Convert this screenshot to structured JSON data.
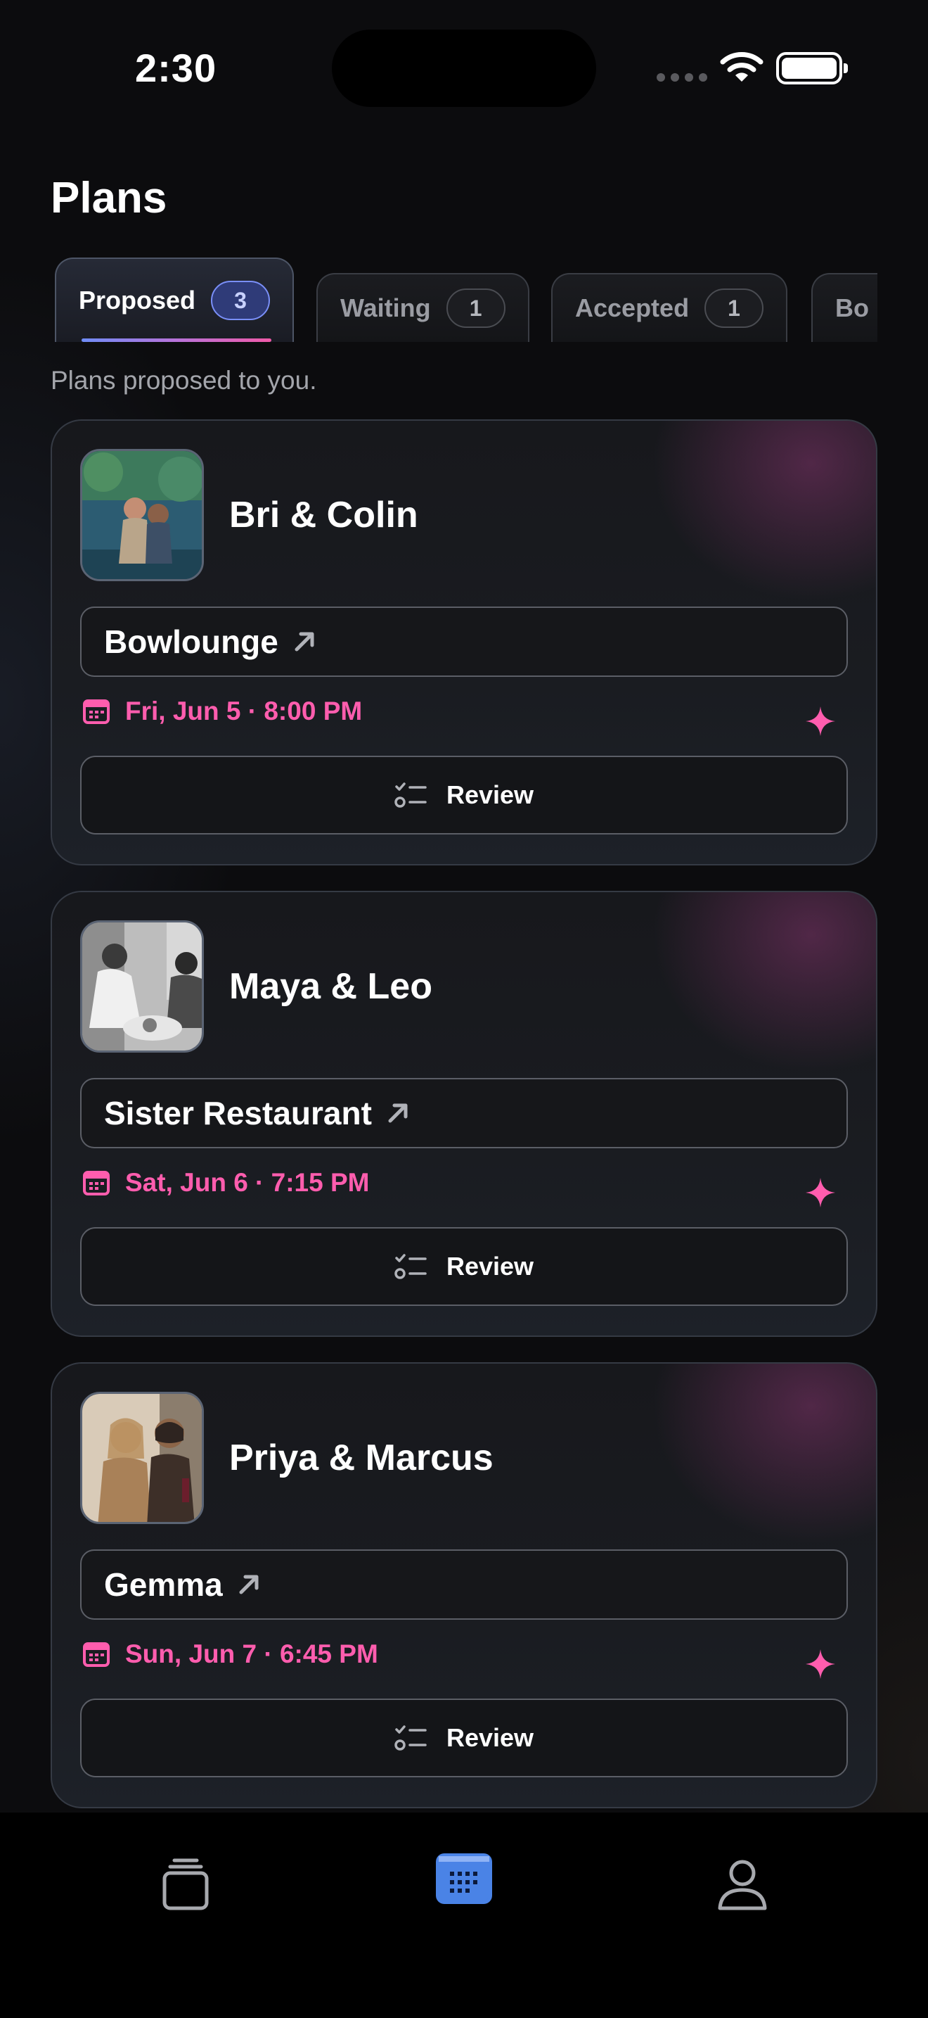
{
  "status_bar": {
    "time": "2:30"
  },
  "page": {
    "title": "Plans",
    "subtitle": "Plans proposed to you."
  },
  "tabs": [
    {
      "label": "Proposed",
      "count": "3",
      "active": true
    },
    {
      "label": "Waiting",
      "count": "1",
      "active": false
    },
    {
      "label": "Accepted",
      "count": "1",
      "active": false
    },
    {
      "label": "Bo",
      "count": "",
      "active": false
    }
  ],
  "plans": [
    {
      "names": "Bri & Colin",
      "venue": "Bowlounge",
      "date": "Fri, Jun 5 · 8:00 PM",
      "action": "Review"
    },
    {
      "names": "Maya & Leo",
      "venue": "Sister Restaurant",
      "date": "Sat, Jun 6 · 7:15 PM",
      "action": "Review"
    },
    {
      "names": "Priya & Marcus",
      "venue": "Gemma",
      "date": "Sun, Jun 7 · 6:45 PM",
      "action": "Review"
    }
  ],
  "tabbar": {
    "items": [
      "cards-stack-icon",
      "calendar-icon",
      "profile-icon"
    ],
    "active": "calendar-icon"
  },
  "colors": {
    "accent_pink": "#ff5dae",
    "accent_blue": "#4a83e6",
    "background": "#0c0c0e"
  }
}
